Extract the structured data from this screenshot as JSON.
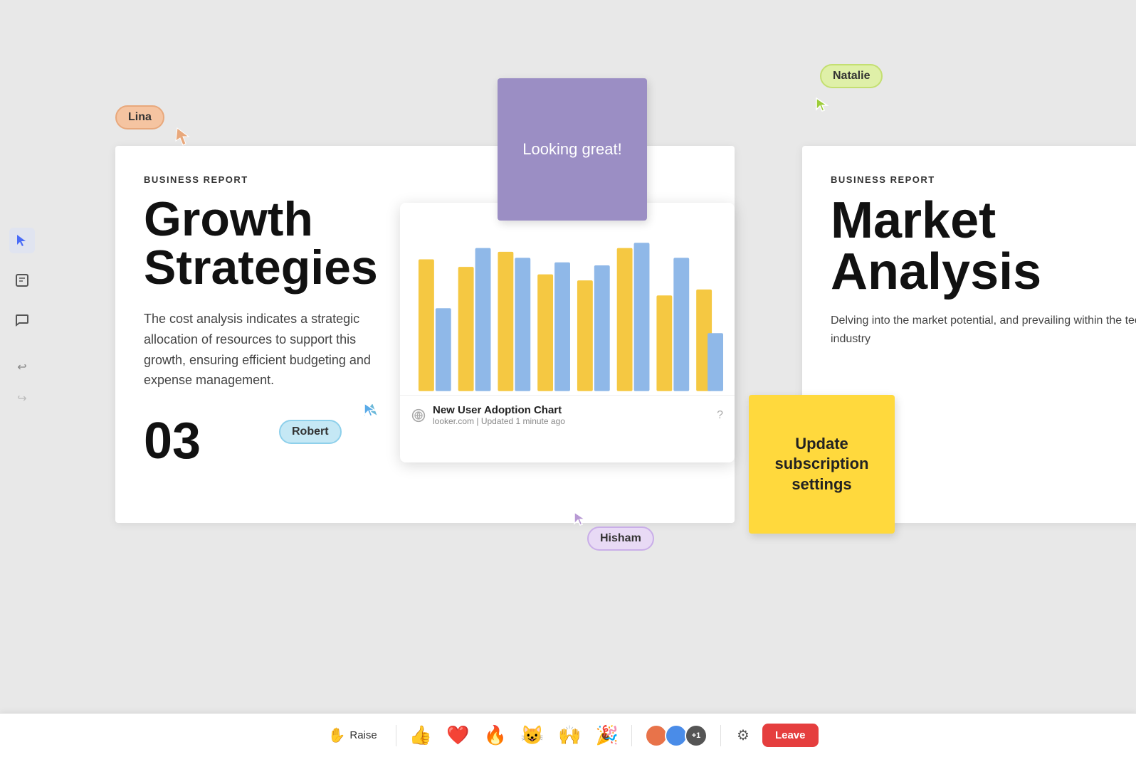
{
  "sidebar": {
    "icons": [
      {
        "name": "cursor-icon",
        "symbol": "▶",
        "active": true
      },
      {
        "name": "note-icon",
        "symbol": "🗒",
        "active": false
      },
      {
        "name": "comment-icon",
        "symbol": "💬",
        "active": false
      }
    ],
    "undo_icon": "↩",
    "redo_icon": "↪"
  },
  "canvas": {
    "background": "#e8e8e8"
  },
  "report1": {
    "label": "BUSINESS REPORT",
    "title": "Growth\nStrategies",
    "description": "The cost analysis indicates a strategic allocation of resources to support this growth, ensuring efficient budgeting and expense management.",
    "number": "03"
  },
  "report2": {
    "label": "BUSINESS REPORT",
    "title": "Market\nAnalysis",
    "description": "Delving into the market potential, and prevailing within the tech industry"
  },
  "sticky_purple": {
    "text": "Looking great!"
  },
  "sticky_yellow": {
    "text": "Update subscription settings"
  },
  "chart": {
    "title": "New User Adoption Chart",
    "source": "looker.com",
    "updated": "Updated 1 minute ago",
    "bars": [
      {
        "yellow": 75,
        "blue": 45
      },
      {
        "yellow": 65,
        "blue": 70
      },
      {
        "yellow": 80,
        "blue": 68
      },
      {
        "yellow": 60,
        "blue": 65
      },
      {
        "yellow": 58,
        "blue": 62
      },
      {
        "yellow": 80,
        "blue": 78
      },
      {
        "yellow": 45,
        "blue": 65
      },
      {
        "yellow": 62,
        "blue": 32
      }
    ]
  },
  "cursors": {
    "lina": {
      "label": "Lina",
      "color": "#f5c4a1"
    },
    "robert": {
      "label": "Robert",
      "color": "#c5e8f5"
    },
    "natalie": {
      "label": "Natalie",
      "color": "#dff0a8"
    },
    "hisham": {
      "label": "Hisham",
      "color": "#e8daf5"
    }
  },
  "toolbar": {
    "raise_label": "Raise",
    "leave_label": "Leave",
    "emojis": [
      "👍",
      "❤️",
      "🔥",
      "😺",
      "🙌",
      "🎉"
    ],
    "participant_count": "+1"
  }
}
